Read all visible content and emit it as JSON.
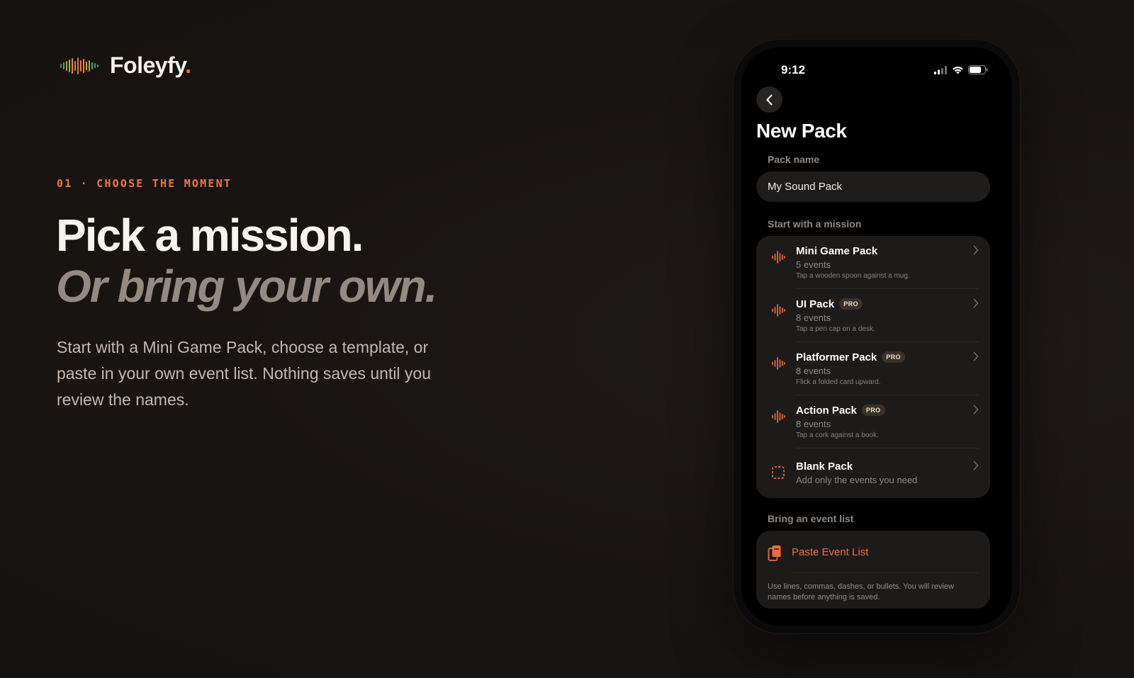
{
  "brand": {
    "name": "Foleyfy",
    "dot": ".",
    "accent": "#f26a3d"
  },
  "hero": {
    "eyebrow": "01 · CHOOSE THE MOMENT",
    "headline_line1": "Pick a mission.",
    "headline_line2": "Or bring your own.",
    "lede": "Start with a Mini Game Pack, choose a template, or paste in your own event list. Nothing saves until you review the names."
  },
  "status_bar": {
    "time": "9:12",
    "icons": [
      "cellular-signal-icon",
      "wifi-icon",
      "battery-icon"
    ]
  },
  "screen": {
    "title": "New Pack",
    "back_icon": "chevron-left-icon",
    "pack_name": {
      "label": "Pack name",
      "value": "My Sound Pack"
    },
    "missions": {
      "label": "Start with a mission",
      "items": [
        {
          "title": "Mini Game Pack",
          "pro": "",
          "count": "5 events",
          "hint": "Tap a wooden spoon against a mug.",
          "icon": "waveform-icon"
        },
        {
          "title": "UI Pack",
          "pro": "PRO",
          "count": "8 events",
          "hint": "Tap a pen cap on a desk.",
          "icon": "waveform-icon"
        },
        {
          "title": "Platformer Pack",
          "pro": "PRO",
          "count": "8 events",
          "hint": "Flick a folded card upward.",
          "icon": "waveform-icon"
        },
        {
          "title": "Action Pack",
          "pro": "PRO",
          "count": "8 events",
          "hint": "Tap a cork against a book.",
          "icon": "waveform-icon"
        },
        {
          "title": "Blank Pack",
          "pro": "",
          "count": "Add only the events you need",
          "hint": "",
          "icon": "dashed-square-icon"
        }
      ]
    },
    "event_list": {
      "label": "Bring an event list",
      "paste_label": "Paste Event List",
      "paste_icon": "clipboard-icon",
      "note": "Use lines, commas, dashes, or bullets. You will review names before anything is saved."
    }
  }
}
